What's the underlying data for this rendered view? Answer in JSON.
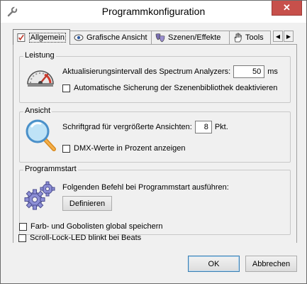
{
  "window": {
    "title": "Programmkonfiguration",
    "close_glyph": "✕"
  },
  "tabs": [
    {
      "label": "Allgemein",
      "icon": "checklist-icon",
      "active": true
    },
    {
      "label": "Grafische Ansicht",
      "icon": "eye-icon",
      "active": false
    },
    {
      "label": "Szenen/Effekte",
      "icon": "theater-masks-icon",
      "active": false
    },
    {
      "label": "Tools",
      "icon": "hand-tool-icon",
      "active": false
    }
  ],
  "tab_scroll": {
    "left": "◀",
    "right": "▶"
  },
  "leistung": {
    "title": "Leistung",
    "interval_label": "Aktualisierungsintervall des Spectrum Analyzers:",
    "interval_value": "50",
    "interval_unit": "ms",
    "autosave_label": "Automatische Sicherung der Szenenbibliothek deaktivieren",
    "autosave_checked": false
  },
  "ansicht": {
    "title": "Ansicht",
    "fontsize_label": "Schriftgrad für vergrößerte Ansichten:",
    "fontsize_value": "8",
    "fontsize_unit": "Pkt.",
    "dmx_label": "DMX-Werte in Prozent anzeigen",
    "dmx_checked": false
  },
  "programmstart": {
    "title": "Programmstart",
    "command_label": "Folgenden Befehl bei Programmstart ausführen:",
    "define_button": "Definieren"
  },
  "global_options": [
    {
      "label": "Farb- und Gobolisten global speichern",
      "checked": false
    },
    {
      "label": "Scroll-Lock-LED blinkt bei Beats",
      "checked": false
    }
  ],
  "buttons": {
    "ok": "OK",
    "cancel": "Abbrechen"
  },
  "colors": {
    "close": "#c7504b",
    "accent_border": "#3c7fb1"
  }
}
